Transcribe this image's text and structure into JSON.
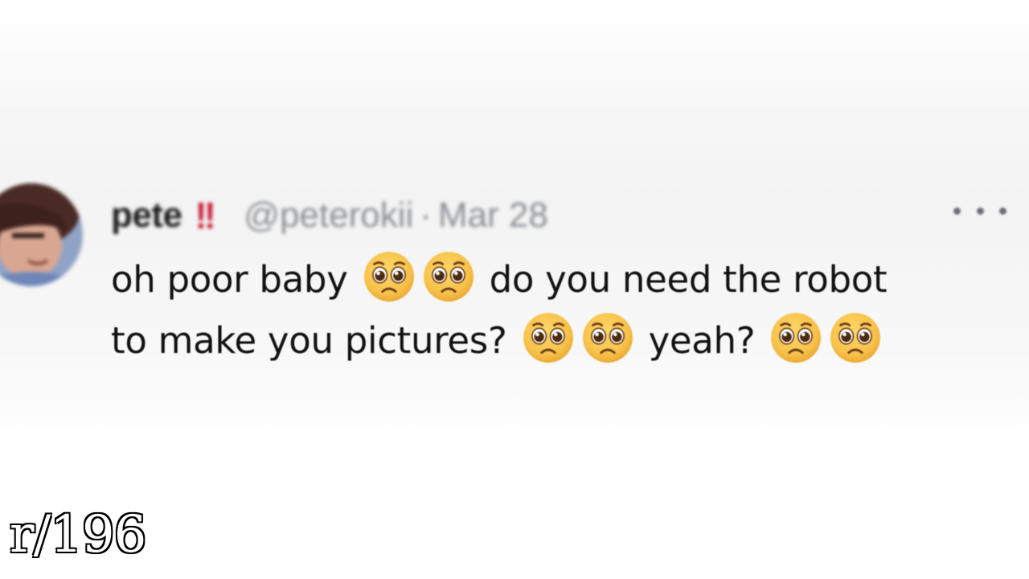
{
  "tweet": {
    "display_name": "pete",
    "name_badge": "‼",
    "handle": "@peterokii",
    "separator": "·",
    "date": "Mar 28",
    "more_icon": "more-horizontal-icon",
    "body": {
      "line1_part1": "oh poor baby",
      "line1_part2": "do you need the robot",
      "line2_part1": "to make you pictures?",
      "line2_part2": "yeah?"
    },
    "emoji_name": "pleading-face-icon"
  },
  "watermark": "r/196",
  "colors": {
    "badge": "#c8102e",
    "secondary_text": "#8a8e93",
    "emoji_face": "#f7c24a"
  }
}
